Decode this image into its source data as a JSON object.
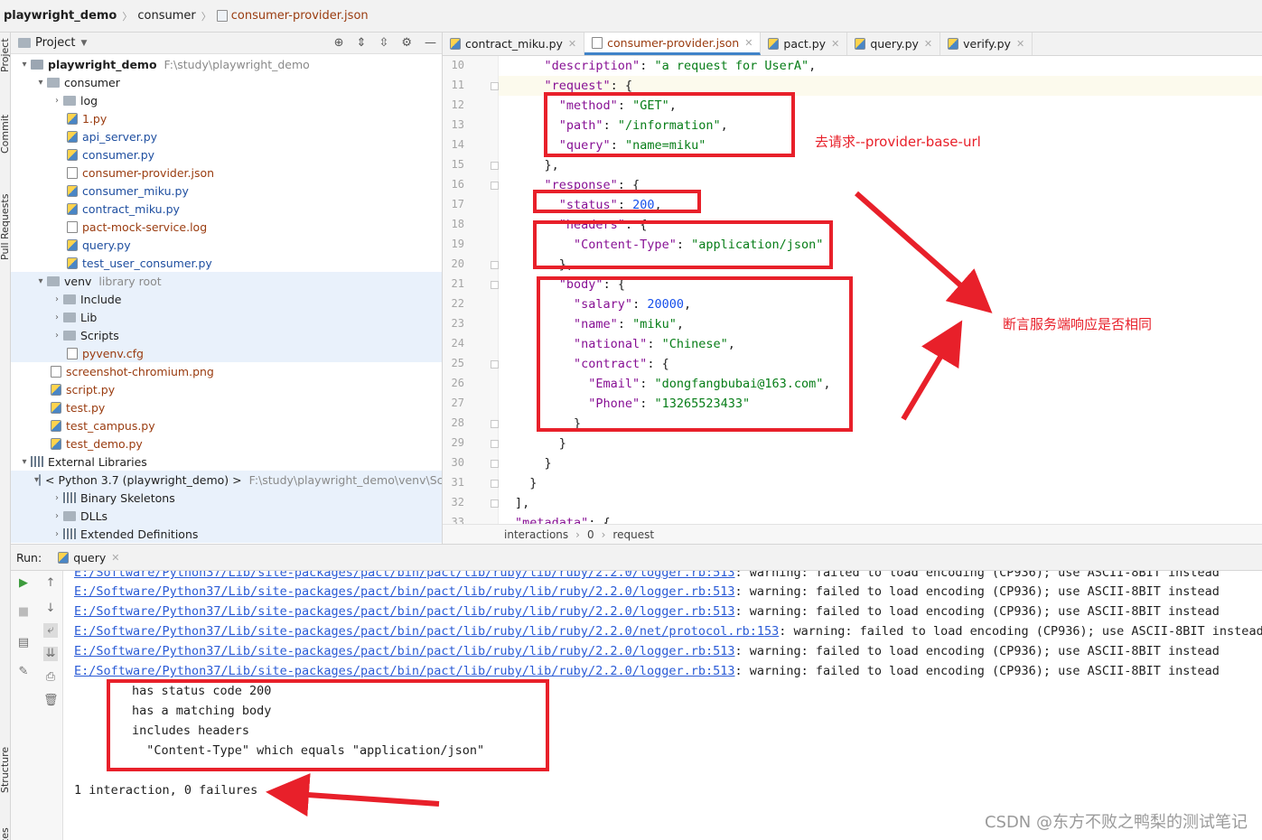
{
  "breadcrumb": {
    "project": "playwright_demo",
    "folder": "consumer",
    "file": "consumer-provider.json"
  },
  "left_stripe": [
    "Project",
    "Commit",
    "Pull Requests",
    "Structure",
    "Favorites"
  ],
  "project_panel": {
    "title": "Project",
    "root": {
      "name": "playwright_demo",
      "path": "F:\\study\\playwright_demo"
    },
    "rows": [
      {
        "label": "consumer",
        "type": "folder"
      },
      {
        "label": "log",
        "type": "folder"
      },
      {
        "label": "1.py",
        "type": "py"
      },
      {
        "label": "api_server.py",
        "type": "py"
      },
      {
        "label": "consumer.py",
        "type": "py"
      },
      {
        "label": "consumer-provider.json",
        "type": "json"
      },
      {
        "label": "consumer_miku.py",
        "type": "py"
      },
      {
        "label": "contract_miku.py",
        "type": "py"
      },
      {
        "label": "pact-mock-service.log",
        "type": "log"
      },
      {
        "label": "query.py",
        "type": "py"
      },
      {
        "label": "test_user_consumer.py",
        "type": "py"
      },
      {
        "label": "venv",
        "type": "folder",
        "extra": "library root"
      },
      {
        "label": "Include",
        "type": "folder"
      },
      {
        "label": "Lib",
        "type": "folder"
      },
      {
        "label": "Scripts",
        "type": "folder"
      },
      {
        "label": "pyvenv.cfg",
        "type": "cfg"
      },
      {
        "label": "screenshot-chromium.png",
        "type": "png"
      },
      {
        "label": "script.py",
        "type": "py"
      },
      {
        "label": "test.py",
        "type": "py"
      },
      {
        "label": "test_campus.py",
        "type": "py"
      },
      {
        "label": "test_demo.py",
        "type": "py"
      },
      {
        "label": "External Libraries",
        "type": "lib"
      },
      {
        "label": "< Python 3.7 (playwright_demo) >",
        "type": "python",
        "extra": "F:\\study\\playwright_demo\\venv\\Scrip"
      },
      {
        "label": "Binary Skeletons",
        "type": "lib"
      },
      {
        "label": "DLLs",
        "type": "folder"
      },
      {
        "label": "Extended Definitions",
        "type": "lib"
      }
    ]
  },
  "tabs": [
    {
      "label": "contract_miku.py"
    },
    {
      "label": "consumer-provider.json"
    },
    {
      "label": "pact.py"
    },
    {
      "label": "query.py"
    },
    {
      "label": "verify.py"
    }
  ],
  "editor": {
    "line_numbers": [
      "10",
      "11",
      "12",
      "13",
      "14",
      "15",
      "16",
      "17",
      "18",
      "19",
      "20",
      "21",
      "22",
      "23",
      "24",
      "25",
      "26",
      "27",
      "28",
      "29",
      "30",
      "31",
      "32",
      "33"
    ],
    "lines": [
      "    \"description\": \"a request for UserA\",",
      "    \"request\": {",
      "      \"method\": \"GET\",",
      "      \"path\": \"/information\",",
      "      \"query\": \"name=miku\"",
      "    },",
      "    \"response\": {",
      "      \"status\": 200,",
      "      \"headers\": {",
      "        \"Content-Type\": \"application/json\"",
      "      },",
      "      \"body\": {",
      "        \"salary\": 20000,",
      "        \"name\": \"miku\",",
      "        \"national\": \"Chinese\",",
      "        \"contract\": {",
      "          \"Email\": \"dongfangbubai@163.com\",",
      "          \"Phone\": \"13265523433\"",
      "        }",
      "      }",
      "    }",
      "  }",
      "],",
      "\"metadata\": {"
    ],
    "crumbs": [
      "interactions",
      "0",
      "request"
    ]
  },
  "annotations": {
    "request": "去请求--provider-base-url",
    "assert": "断言服务端响应是否相同"
  },
  "run": {
    "label": "Run:",
    "config": "query",
    "log_path": "E:/Software/Python37/Lib/site-packages/pact/bin/pact/lib/ruby/lib/ruby/2.2.0/logger.rb:513",
    "log_path2": "E:/Software/Python37/Lib/site-packages/pact/bin/pact/lib/ruby/lib/ruby/2.2.0/net/protocol.rb:153",
    "warning": ": warning: failed to load encoding (CP936); use ASCII-8BIT instead",
    "result_lines": [
      "has status code 200",
      "has a matching body",
      "includes headers",
      "  \"Content-Type\" which equals \"application/json\""
    ],
    "summary": "1 interaction, 0 failures"
  },
  "watermark": "CSDN @东方不败之鸭梨的测试笔记",
  "colors": {
    "annotation_red": "#e8202a",
    "tab_accent": "#4083c9",
    "link_blue": "#2a5bd6"
  }
}
